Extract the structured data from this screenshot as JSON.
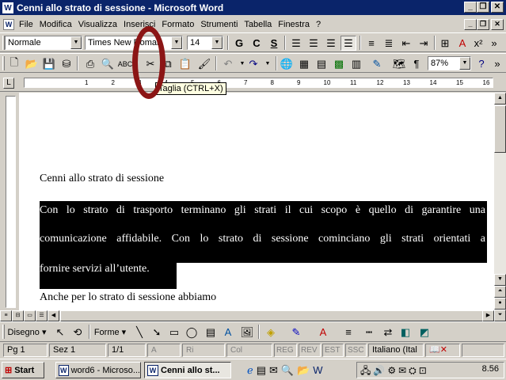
{
  "window": {
    "title": "Cenni allo strato di sessione - Microsoft Word",
    "app_icon": "word-icon"
  },
  "menu": [
    "File",
    "Modifica",
    "Visualizza",
    "Inserisci",
    "Formato",
    "Strumenti",
    "Tabella",
    "Finestra",
    "?"
  ],
  "formatting": {
    "style": "Normale",
    "font": "Times New Roman",
    "size": "14",
    "bold": "G",
    "italic": "C",
    "underline": "S"
  },
  "standard": {
    "zoom": "87%"
  },
  "tooltip": "Taglia (CTRL+X)",
  "ruler_numbers": [
    "1",
    "2",
    "3",
    "4",
    "5",
    "6",
    "7",
    "8",
    "9",
    "10",
    "11",
    "12",
    "13",
    "14",
    "15",
    "16"
  ],
  "document": {
    "heading": "Cenni allo strato di sessione",
    "para_lines": [
      "Con lo strato di trasporto terminano gli strati il cui scopo è quello di garantire una",
      "comunicazione affidabile. Con lo strato di sessione cominciano gli strati orientati a",
      "fornire servizi all’utente."
    ],
    "next_line": "Anche per lo strato di sessione abbiamo"
  },
  "drawing": {
    "draw_label": "Disegno",
    "shapes_label": "Forme"
  },
  "status": {
    "page": "Pg 1",
    "section": "Sez 1",
    "pages": "1/1",
    "at": "A",
    "line": "Ri",
    "col": "Col",
    "rec": "REG",
    "rev": "REV",
    "ext": "EST",
    "ovr": "SSC",
    "language": "Italiano (Ital"
  },
  "taskbar": {
    "start": "Start",
    "tasks": [
      "word6 - Microso...",
      "Cenni allo st..."
    ],
    "clock": "8.56"
  },
  "colors": {
    "title_bar": "#0a246a",
    "chrome": "#d4d0c8",
    "annotation": "#8b1515"
  }
}
